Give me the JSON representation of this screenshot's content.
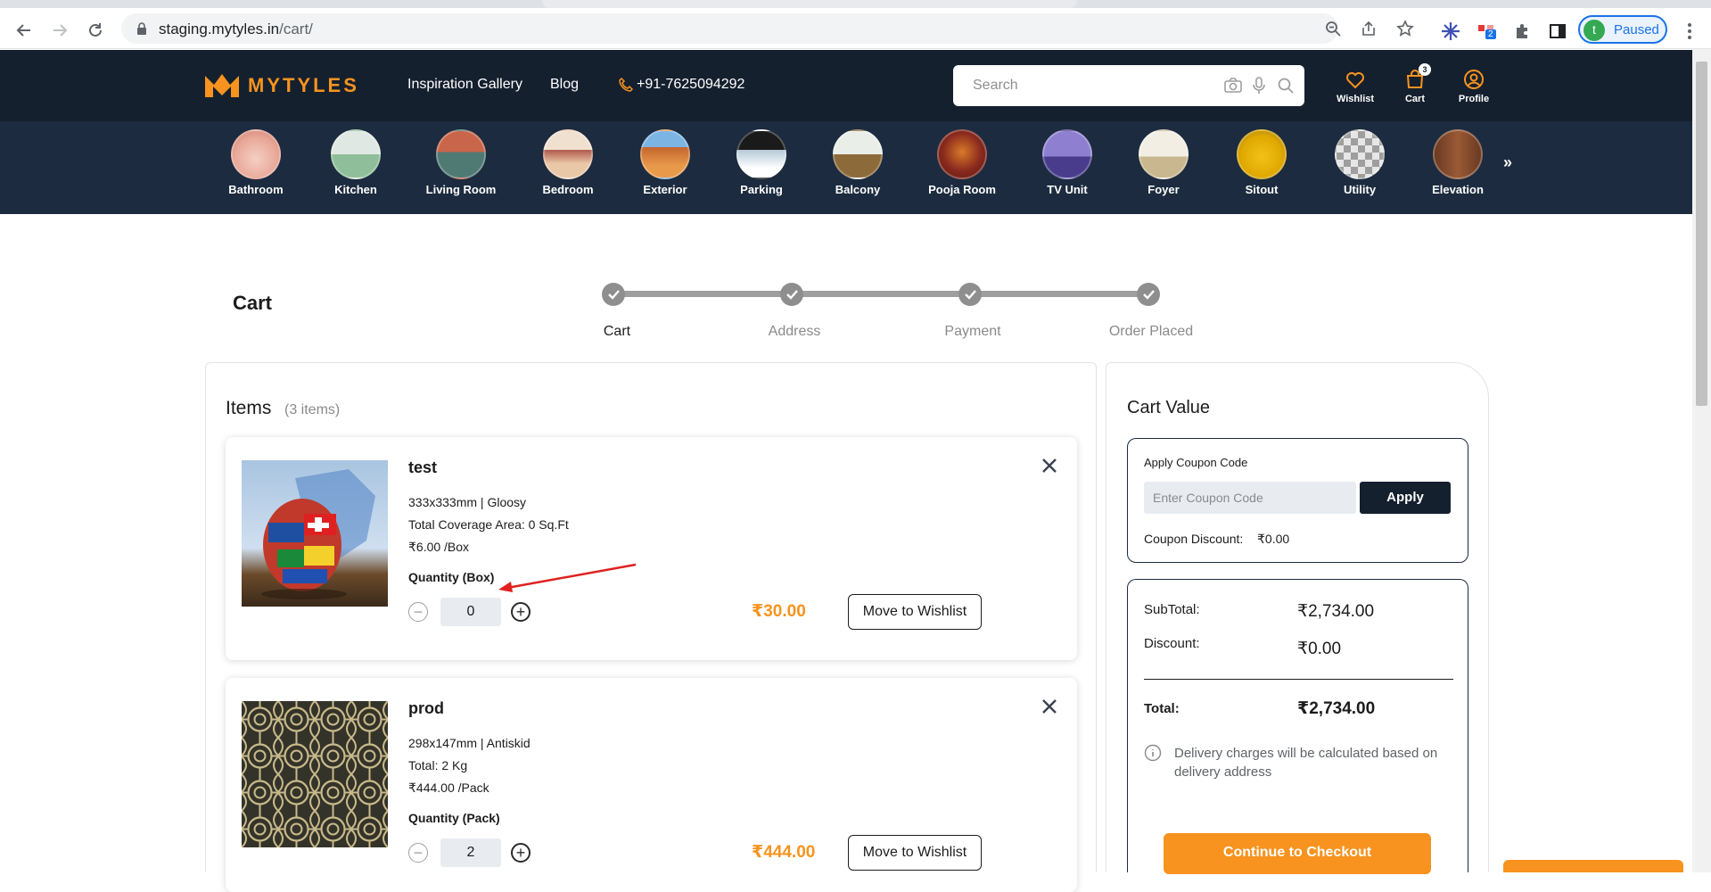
{
  "browser": {
    "url_domain": "staging.mytyles.in",
    "url_path": "/cart/",
    "profile_initial": "t",
    "profile_label": "Paused",
    "extension_badge": "2"
  },
  "site": {
    "brand": "MYTYLES",
    "nav": [
      "Inspiration Gallery",
      "Blog"
    ],
    "phone": "+91-7625094292",
    "search_placeholder": "Search",
    "wishlist_label": "Wishlist",
    "cart_label": "Cart",
    "cart_count": "3",
    "profile_label": "Profile",
    "accent_color": "#f7931e",
    "header_color": "#15202e"
  },
  "categories": [
    "Bathroom",
    "Kitchen",
    "Living Room",
    "Bedroom",
    "Exterior",
    "Parking",
    "Balcony",
    "Pooja Room",
    "TV Unit",
    "Foyer",
    "Sitout",
    "Utility",
    "Elevation"
  ],
  "categories_more": "»",
  "cart": {
    "title": "Cart",
    "steps": [
      "Cart",
      "Address",
      "Payment",
      "Order Placed"
    ],
    "items_heading": "Items",
    "items_count": "(3 items)",
    "items": [
      {
        "name": "test",
        "spec": "333x333mm | Gloosy",
        "detail": "Total Coverage Area: 0 Sq.Ft",
        "unit_price": "₹6.00 /Box",
        "qty_label": "Quantity (Box)",
        "qty": "0",
        "price": "₹30.00",
        "wishlist_btn": "Move to Wishlist"
      },
      {
        "name": "prod",
        "spec": "298x147mm | Antiskid",
        "detail": "Total: 2 Kg",
        "unit_price": "₹444.00 /Pack",
        "qty_label": "Quantity (Pack)",
        "qty": "2",
        "price": "₹444.00",
        "wishlist_btn": "Move to Wishlist"
      }
    ]
  },
  "cart_value": {
    "title": "Cart Value",
    "coupon_label": "Apply Coupon Code",
    "coupon_placeholder": "Enter Coupon Code",
    "apply_btn": "Apply",
    "coupon_discount_label": "Coupon Discount:",
    "coupon_discount_value": "₹0.00",
    "subtotal_label": "SubTotal:",
    "subtotal_value": "₹2,734.00",
    "discount_label": "Discount:",
    "discount_value": "₹0.00",
    "total_label": "Total:",
    "total_value": "₹2,734.00",
    "delivery_note": "Delivery charges will be calculated based on delivery address",
    "checkout_btn": "Continue to Checkout"
  }
}
